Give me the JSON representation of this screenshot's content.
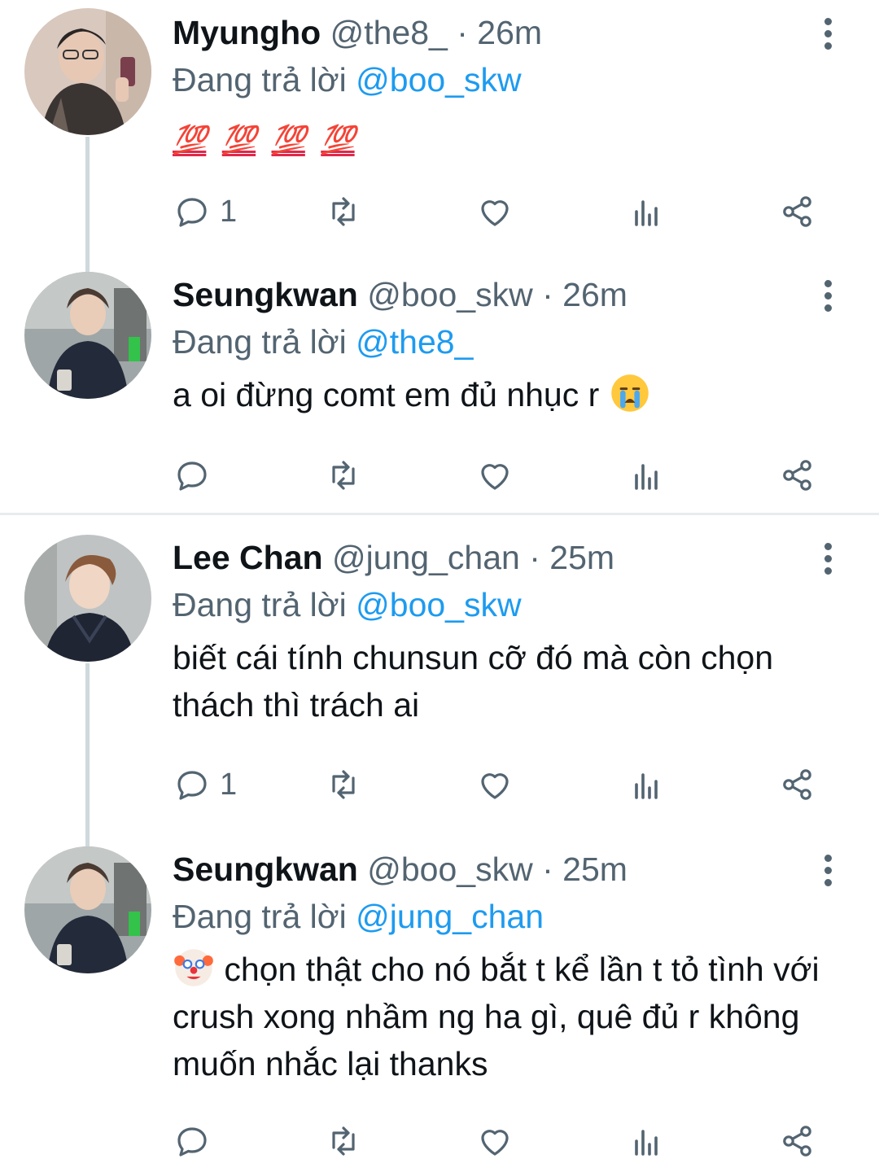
{
  "tweets": [
    {
      "name": "Myungho",
      "handle": "@the8_",
      "time": "26m",
      "reply_prefix": "Đang trả lời",
      "reply_to": "@boo_skw",
      "emoji_text": [
        "💯",
        "💯",
        "💯",
        "💯"
      ],
      "text": "",
      "reply_count": "1"
    },
    {
      "name": "Seungkwan",
      "handle": "@boo_skw",
      "time": "26m",
      "reply_prefix": "Đang trả lời",
      "reply_to": "@the8_",
      "text": "a oi đừng comt em đủ nhục r",
      "reply_count": ""
    },
    {
      "name": "Lee Chan",
      "handle": "@jung_chan",
      "time": "25m",
      "reply_prefix": "Đang trả lời",
      "reply_to": "@boo_skw",
      "text": "biết cái tính chunsun cỡ đó mà còn chọn thách thì trách ai",
      "reply_count": "1"
    },
    {
      "name": "Seungkwan",
      "handle": "@boo_skw",
      "time": "25m",
      "reply_prefix": "Đang trả lời",
      "reply_to": "@jung_chan",
      "text": "chọn thật cho nó bắt t kể lần t tỏ tình với crush xong nhầm ng ha gì, quê đủ r không muốn nhắc lại thanks",
      "reply_count": ""
    }
  ],
  "separator": "·",
  "icons": {
    "reply": "reply-icon",
    "retweet": "retweet-icon",
    "like": "like-icon",
    "views": "views-icon",
    "share": "share-icon",
    "more": "more-icon"
  },
  "colors": {
    "accent": "#1d9bf0",
    "secondary_text": "#536471",
    "thread_line": "#cfd9de"
  }
}
